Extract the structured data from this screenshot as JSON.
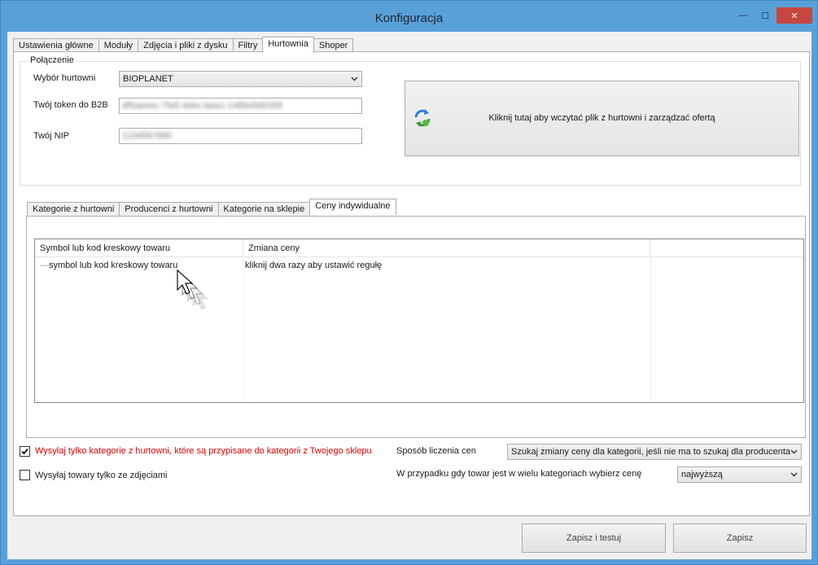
{
  "window": {
    "title": "Konfiguracja",
    "minimize_glyph": "—",
    "maximize_glyph": "☐",
    "close_glyph": "✕"
  },
  "main_tabs": [
    {
      "label": "Ustawienia główne"
    },
    {
      "label": "Moduły"
    },
    {
      "label": "Zdjęcia i pliki z dysku"
    },
    {
      "label": "Filtry"
    },
    {
      "label": "Hurtownia",
      "active": true
    },
    {
      "label": "Shoper"
    }
  ],
  "connection": {
    "group_title": "Połączenie",
    "wholesaler_label": "Wybór hurtowni",
    "wholesaler_value": "BIOPLANET",
    "token_label": "Twój token do B2B",
    "token_value": "df5aeeec-7fe5-4ebc-bea1-148bd3d0358",
    "nip_label": "Twój NIP",
    "nip_value": "1234567890",
    "load_button_label": "Kliknij tutaj aby wczytać plik z hurtowni i zarządzać ofertą",
    "load_button_icon": "refresh-icon"
  },
  "sub_tabs": [
    {
      "label": "Kategorie z hurtowni"
    },
    {
      "label": "Producenci z hurtowni"
    },
    {
      "label": "Kategorie na sklepie"
    },
    {
      "label": "Ceny indywidualne",
      "active": true
    }
  ],
  "price_list": {
    "columns": [
      "Symbol lub kod kreskowy towaru",
      "Zmiana ceny"
    ],
    "rows": [
      {
        "symbol": "symbol lub kod kreskowy towaru",
        "change": "kliknij dwa razy aby ustawić regułę"
      }
    ]
  },
  "options": {
    "only_assigned_categories": {
      "label": "Wysyłaj tylko kategorie z hurtowni, które są przypisane do kategorii z Twojego sklepu",
      "checked": true,
      "color": "#e00000"
    },
    "only_with_photos": {
      "label": "Wysyłaj towary tylko ze zdjęciami",
      "checked": false
    },
    "pricing_method_label": "Sposób liczenia cen",
    "pricing_method_value": "Szukaj zmiany ceny dla kategorii, jeśli nie ma to szukaj dla producenta",
    "multi_category_label": "W przypadku gdy towar jest w wielu kategoriach wybierz cenę",
    "multi_category_value": "najwyższą"
  },
  "footer": {
    "save_test_label": "Zapisz i testuj",
    "save_label": "Zapisz"
  }
}
